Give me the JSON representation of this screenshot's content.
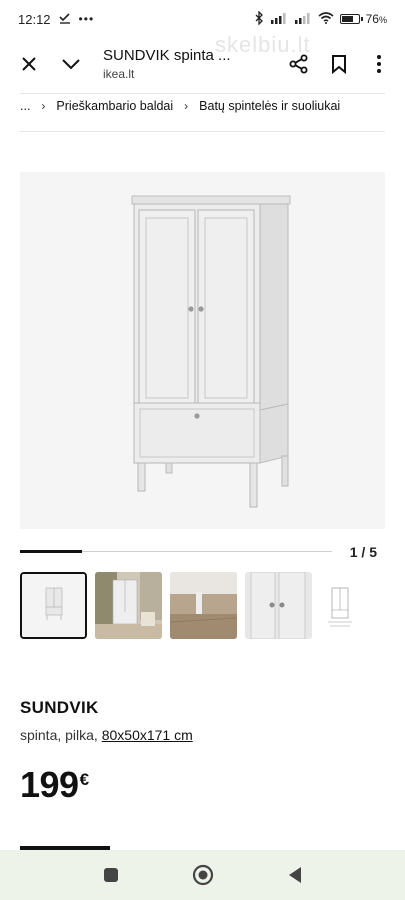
{
  "status_bar": {
    "time": "12:12",
    "battery_percent": "76",
    "battery_suffix": "%",
    "battery_level": 0.76
  },
  "browser": {
    "title": "SUNDVIK spinta ...",
    "url": "ikea.lt",
    "watermark": "skelbiu.lt"
  },
  "breadcrumb": {
    "ellipsis": "...",
    "items": [
      "Prieškambario baldai",
      "Batų spintelės ir suoliukai"
    ]
  },
  "gallery": {
    "pager": "1 / 5",
    "progress": 0.2,
    "thumbnails": [
      "wardrobe-front",
      "room-scene",
      "leg-detail",
      "knob-detail",
      "drawing"
    ]
  },
  "product": {
    "name": "SUNDVIK",
    "description_prefix": "spinta, pilka,",
    "dimensions": "80x50x171 cm",
    "price": "199",
    "currency": "€"
  },
  "colors": {
    "accent": "#111111",
    "nav_bar_bg": "#eef3e9",
    "image_bg": "#f5f5f5"
  }
}
